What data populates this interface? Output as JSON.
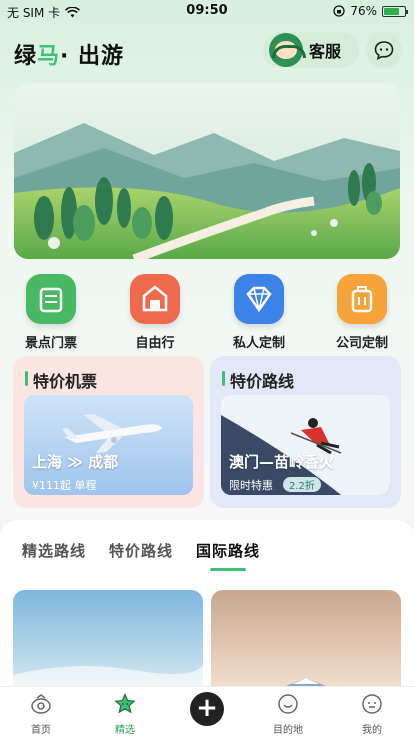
{
  "status_bar": {
    "carrier": "无 SIM 卡",
    "time": "09:50",
    "battery": "76%",
    "battery_level": 0.76
  },
  "header": {
    "brand_a": "绿",
    "brand_b": "马",
    "brand_c": "· 出游",
    "service_label": "客服"
  },
  "quick_menu": [
    {
      "label": "景点门票",
      "icon": "ticket-icon",
      "color": "#48b865"
    },
    {
      "label": "自由行",
      "icon": "gate-icon",
      "color": "#ee6a4e"
    },
    {
      "label": "私人定制",
      "icon": "diamond-icon",
      "color": "#3d82e6"
    },
    {
      "label": "公司定制",
      "icon": "luggage-icon",
      "color": "#f5a33a"
    }
  ],
  "cards": {
    "flights": {
      "title": "特价机票",
      "route": "上海 ≫ 成都",
      "price": "¥111起 单程"
    },
    "routes": {
      "title": "特价路线",
      "route": "澳门—苗岭香火",
      "promo": "限时特惠",
      "discount": "2.2折"
    }
  },
  "tabs": [
    {
      "label": "精选路线",
      "active": false
    },
    {
      "label": "特价路线",
      "active": false
    },
    {
      "label": "国际路线",
      "active": true
    }
  ],
  "tab_bar": [
    {
      "label": "首页",
      "icon": "home-icon",
      "active": false
    },
    {
      "label": "精选",
      "icon": "star-icon",
      "active": true
    },
    {
      "label": "目的地",
      "icon": "destination-icon",
      "active": false
    },
    {
      "label": "我的",
      "icon": "profile-icon",
      "active": false
    }
  ],
  "colors": {
    "accent": "#3fbf74",
    "sheet": "#ffffff"
  }
}
